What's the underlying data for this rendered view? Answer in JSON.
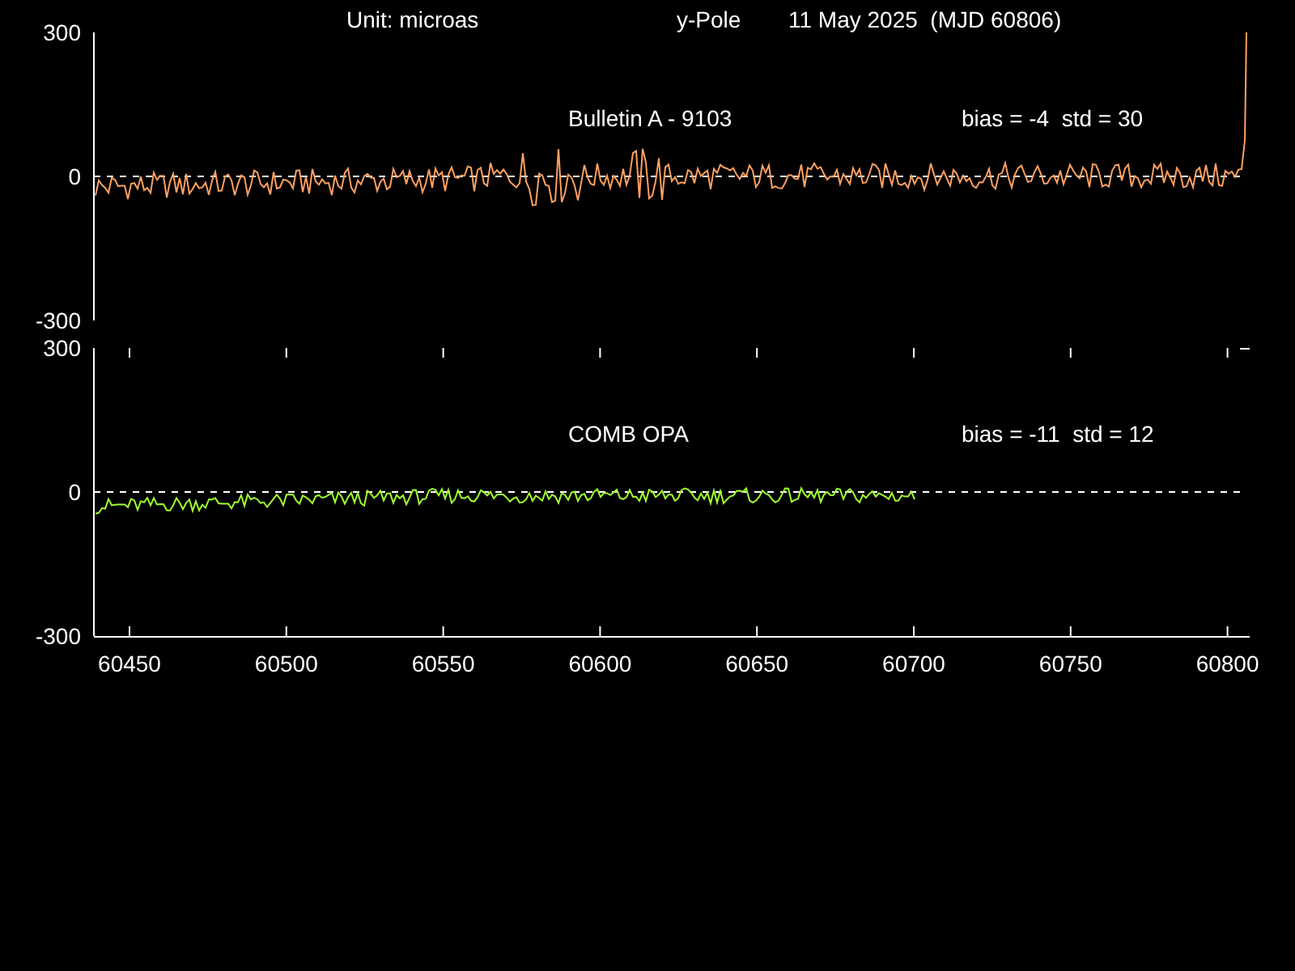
{
  "header": {
    "unit": "Unit: microas",
    "component": "y-Pole",
    "date": "11 May 2025  (MJD 60806)"
  },
  "panels": [
    {
      "title": "Bulletin A - 9103",
      "stats": "bias = -4  std = 30",
      "color": "#ffa060",
      "y_ticks": [
        "300",
        "0",
        "-300"
      ],
      "kind": "full"
    },
    {
      "title": "COMB OPA",
      "stats": "bias = -11  std = 12",
      "color": "#a0ff30",
      "y_ticks": [
        "300",
        "0",
        "-300"
      ],
      "kind": "partial"
    }
  ],
  "x_ticks": [
    "60450",
    "60500",
    "60550",
    "60600",
    "60650",
    "60700",
    "60750",
    "60800"
  ]
}
